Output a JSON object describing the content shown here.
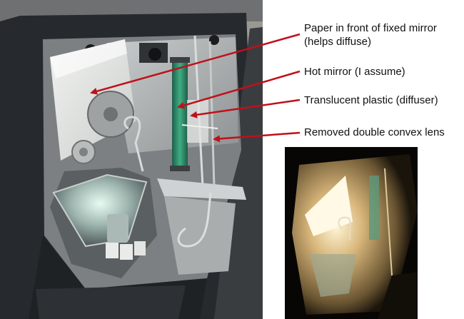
{
  "annotations": {
    "paper": "Paper in front of fixed mirror (helps diffuse)",
    "hot_mirror": "Hot mirror (I assume)",
    "translucent_plastic": "Translucent plastic (diffuser)",
    "removed_lens": "Removed double convex lens"
  },
  "colors": {
    "arrow": "#c0101a",
    "housing": "#2a2d31",
    "metal": "#b9bcbc",
    "green_filter": "#2f8f6a",
    "glow": "#f3e3b8"
  }
}
